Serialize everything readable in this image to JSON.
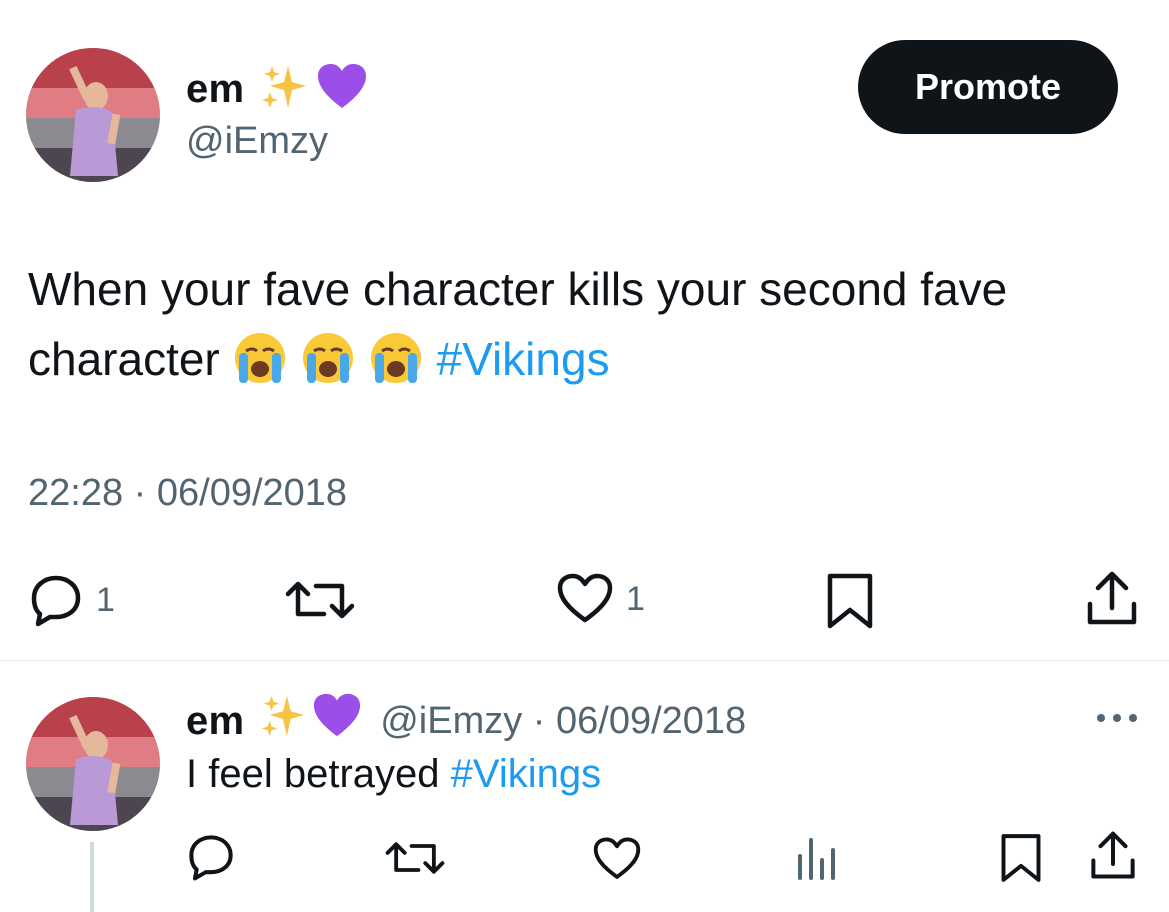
{
  "tweet": {
    "display_name": "em",
    "name_emojis": [
      "sparkles-emoji",
      "purple-heart-emoji"
    ],
    "handle": "@iEmzy",
    "promote_label": "Promote",
    "text_before": "When your fave character kills your second fave character",
    "emojis": [
      "loudly-crying-emoji",
      "loudly-crying-emoji",
      "loudly-crying-emoji"
    ],
    "hashtag": "#Vikings",
    "timestamp": "22:28 · 06/09/2018",
    "actions": {
      "reply_count": "1",
      "like_count": "1"
    }
  },
  "reply": {
    "display_name": "em",
    "handle_date": "@iEmzy · 06/09/2018",
    "text_before": "I feel betrayed",
    "hashtag": "#Vikings"
  },
  "colors": {
    "text": "#0f1419",
    "secondary": "#536471",
    "link": "#1d9bf0",
    "button_bg": "#0f1419",
    "purple_heart": "#9b4ee8"
  }
}
